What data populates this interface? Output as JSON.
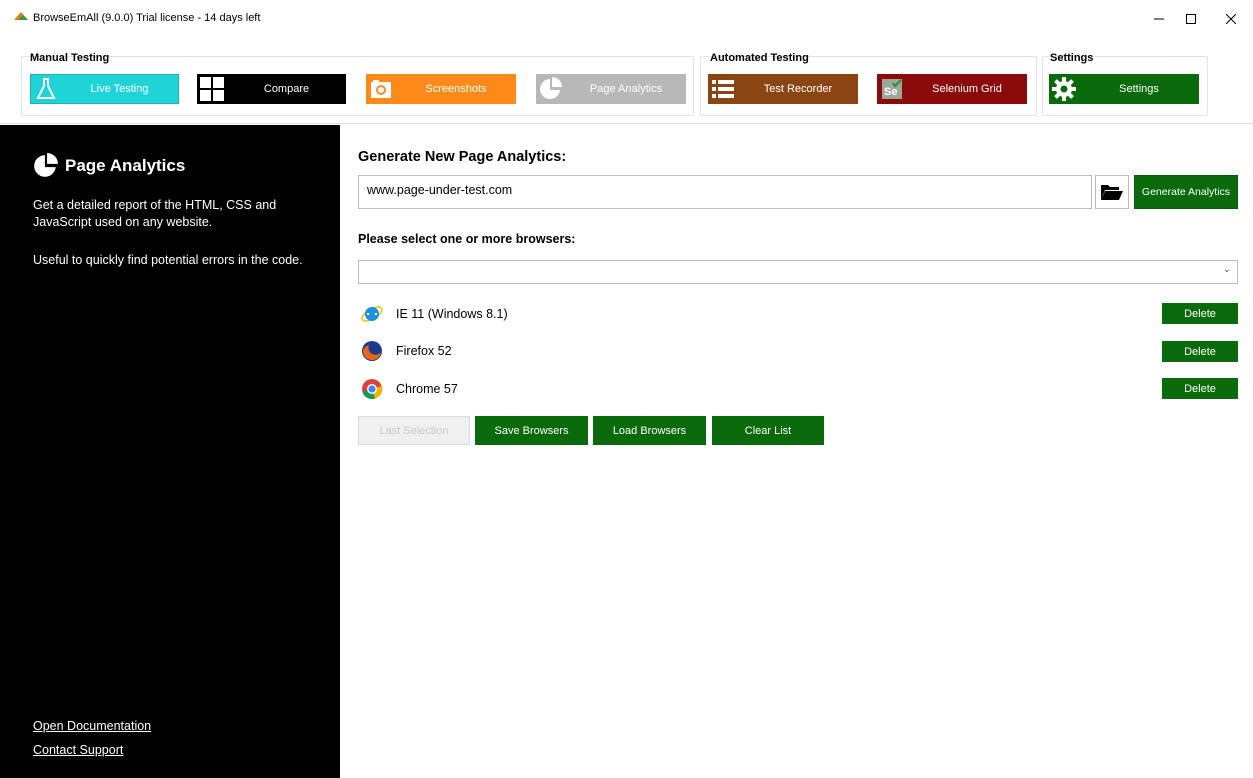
{
  "window": {
    "title": "BrowseEmAll (9.0.0) Trial license - 14 days left",
    "minimize": "–",
    "maximize": "☐",
    "close": "✕"
  },
  "ribbon": {
    "manual": {
      "label": "Manual Testing",
      "live_testing": "Live Testing",
      "compare": "Compare",
      "screenshots": "Screenshots",
      "page_analytics": "Page Analytics"
    },
    "automated": {
      "label": "Automated Testing",
      "test_recorder": "Test Recorder",
      "selenium_grid": "Selenium Grid"
    },
    "settings": {
      "label": "Settings",
      "settings": "Settings"
    }
  },
  "sidebar": {
    "title": "Page Analytics",
    "description": "Get a detailed report of the HTML, CSS and JavaScript used on any website.",
    "description2": "Useful to quickly find potential errors in the code.",
    "open_docs": "Open Documentation",
    "contact_support": "Contact Support"
  },
  "main": {
    "heading": "Generate New Page Analytics:",
    "url_value": "www.page-under-test.com",
    "generate_button": "Generate Analytics",
    "browsers_heading": "Please select one or more browsers:",
    "select_value": "",
    "browsers": [
      {
        "name": "IE 11 (Windows 8.1)",
        "icon": "ie-icon",
        "delete": "Delete"
      },
      {
        "name": "Firefox 52",
        "icon": "firefox-icon",
        "delete": "Delete"
      },
      {
        "name": "Chrome 57",
        "icon": "chrome-icon",
        "delete": "Delete"
      }
    ],
    "actions": {
      "last_selection": "Last Selection",
      "save_browsers": "Save Browsers",
      "load_browsers": "Load Browsers",
      "clear_list": "Clear List"
    }
  },
  "colors": {
    "live_testing": "#1fd3d6",
    "compare": "#000000",
    "screenshots": "#ff8a1a",
    "page_analytics": "#b8b8b8",
    "test_recorder": "#8b4513",
    "selenium_grid": "#8b0a0a",
    "settings": "#0b6a0b",
    "action_green": "#0b6a0b"
  }
}
